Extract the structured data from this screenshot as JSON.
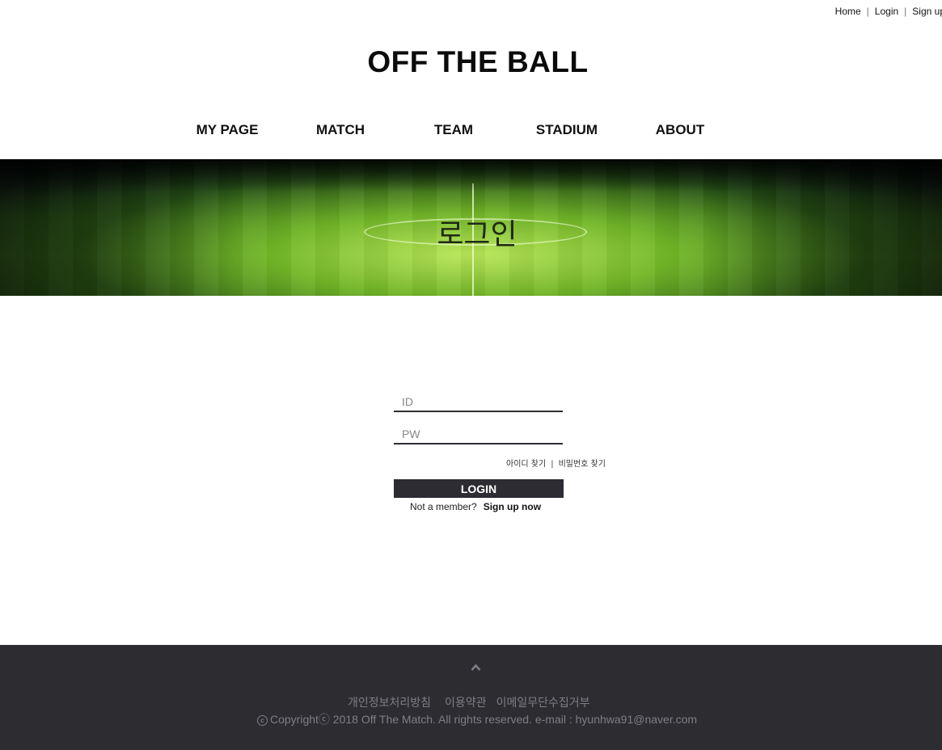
{
  "utility_nav": {
    "home": "Home",
    "login": "Login",
    "signup": "Sign up",
    "separator": "|"
  },
  "site_title": "OFF THE BALL",
  "main_nav": [
    "MY PAGE",
    "MATCH",
    "TEAM",
    "STADIUM",
    "ABOUT"
  ],
  "hero": {
    "title": "로그인"
  },
  "login_form": {
    "id_placeholder": "ID",
    "pw_placeholder": "PW",
    "find_id": "아이디 찾기",
    "find_pw": "비밀번호 찾기",
    "separator": "|",
    "submit_label": "LOGIN",
    "not_member": "Not a member?",
    "signup_link": "Sign up now"
  },
  "footer": {
    "scroll_top_icon": "chevron-up-icon",
    "links": [
      "개인정보처리방침",
      "이용약관",
      "이메일무단수집거부"
    ],
    "copyright_symbol": "c",
    "copyright": "Copyrightⓒ 2018 Off The Match. All rights reserved. e-mail : hyunhwa91@naver.com"
  },
  "colors": {
    "dark_bar": "#2d2c33",
    "footer_bg": "#2d2c31",
    "footer_text": "#7f7e86",
    "pitch_green": "#5a9a2a"
  }
}
